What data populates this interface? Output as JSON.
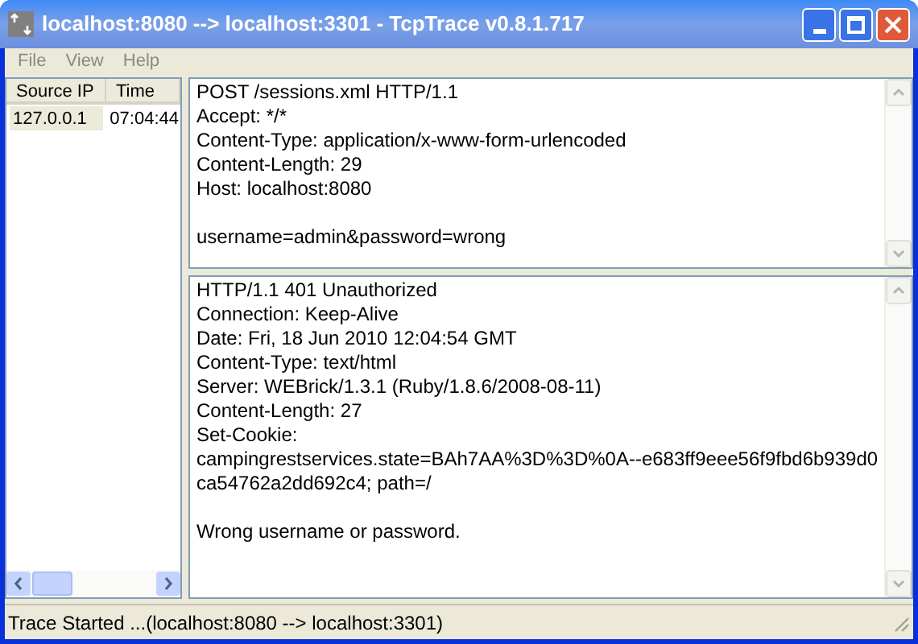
{
  "window": {
    "title": "localhost:8080 --> localhost:3301 - TcpTrace v0.8.1.717"
  },
  "menu": [
    {
      "label": "File",
      "disabled": true
    },
    {
      "label": "View",
      "disabled": true
    },
    {
      "label": "Help",
      "disabled": true
    }
  ],
  "connections": {
    "columns": [
      "Source IP",
      "Time"
    ],
    "rows": [
      {
        "cells": [
          "127.0.0.1",
          "07:04:44"
        ],
        "selected": true
      }
    ]
  },
  "request": {
    "headers": [
      "POST /sessions.xml HTTP/1.1",
      "Accept: */*",
      "Content-Type: application/x-www-form-urlencoded",
      "Content-Length: 29",
      "Host: localhost:8080"
    ],
    "body": "username=admin&password=wrong"
  },
  "response": {
    "headers": [
      "HTTP/1.1 401 Unauthorized",
      "Connection: Keep-Alive",
      "Date: Fri, 18 Jun 2010 12:04:54 GMT",
      "Content-Type: text/html",
      "Server: WEBrick/1.3.1 (Ruby/1.8.6/2008-08-11)",
      "Content-Length: 27",
      "Set-Cookie:",
      "campingrestservices.state=BAh7AA%3D%3D%0A--e683ff9eee56f9fbd6b939d0",
      "ca54762a2dd692c4; path=/"
    ],
    "body": "Wrong username or password."
  },
  "status_bar": "Trace Started ...(localhost:8080 --> localhost:3301)"
}
